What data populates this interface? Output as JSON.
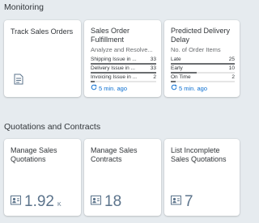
{
  "sections": {
    "monitoring_title": "Monitoring",
    "quotations_title": "Quotations and Contracts"
  },
  "tiles": {
    "track_sales_orders": {
      "title": "Track Sales Orders",
      "icon": "document-list-icon"
    },
    "sales_order_fulfillment": {
      "title": "Sales Order Fulfillment",
      "subtitle": "Analyze and Resolve...",
      "rows": [
        {
          "label": "Shipping Issue in ...",
          "value": "33",
          "fraction": 1.0
        },
        {
          "label": "Delivery Issue in ...",
          "value": "33",
          "fraction": 1.0
        },
        {
          "label": "Invoicing Issue in ...",
          "value": "2",
          "fraction": 0.06
        }
      ],
      "refresh": "5 min. ago"
    },
    "predicted_delivery_delay": {
      "title": "Predicted Delivery Delay",
      "subtitle": "No. of Order Items",
      "rows": [
        {
          "label": "Late",
          "value": "25",
          "fraction": 1.0
        },
        {
          "label": "Early",
          "value": "10",
          "fraction": 0.4
        },
        {
          "label": "On Time",
          "value": "2",
          "fraction": 0.08
        }
      ],
      "refresh": "5 min. ago"
    },
    "manage_sales_quotations": {
      "title": "Manage Sales Quotations",
      "number": "1.92",
      "unit": "K",
      "icon": "contact-card-icon"
    },
    "manage_sales_contracts": {
      "title": "Manage Sales Contracts",
      "number": "18",
      "icon": "contact-card-icon"
    },
    "list_incomplete_sales_quotations": {
      "title": "List Incomplete Sales Quotations",
      "number": "7",
      "icon": "contact-card-icon"
    }
  },
  "colors": {
    "background": "#e6ebef",
    "accent": "#0a6ed1",
    "kpi": "#5b738b"
  }
}
